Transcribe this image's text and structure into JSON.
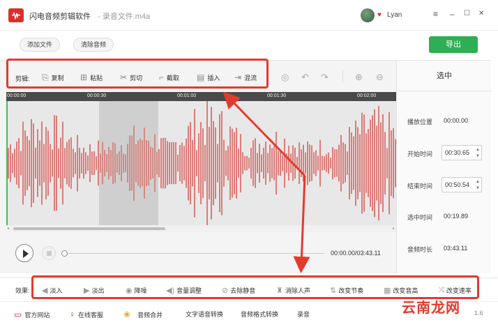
{
  "app": {
    "title": "闪电音频剪辑软件",
    "file_title": "- 录音文件.m4a",
    "user_name": "Lyan"
  },
  "window_controls": {
    "menu": "≡",
    "minimize": "–",
    "maximize": "☐",
    "close": "✕"
  },
  "toolbar": {
    "add_file": "添加文件",
    "clear_audio": "清除音频",
    "export": "导出"
  },
  "edit": {
    "label": "剪辑:",
    "tools": [
      {
        "label": "复制",
        "icon": "copy-icon"
      },
      {
        "label": "粘贴",
        "icon": "paste-icon"
      },
      {
        "label": "剪切",
        "icon": "scissors-icon"
      },
      {
        "label": "截取",
        "icon": "crop-icon"
      },
      {
        "label": "插入",
        "icon": "insert-icon"
      },
      {
        "label": "混流",
        "icon": "mix-icon"
      }
    ],
    "extra_icons": [
      "headphones-icon",
      "undo-icon",
      "redo-icon",
      "zoom-in-icon",
      "zoom-out-icon"
    ]
  },
  "timeline": {
    "ticks": [
      "00:00:00",
      "00:00:30",
      "00:01:00",
      "00:01:30",
      "00:02:00"
    ]
  },
  "selection_panel": {
    "header": "选中",
    "play_position_label": "播放位置",
    "play_position": "00:00.00",
    "start_label": "开始时间",
    "start": "00:30.65",
    "end_label": "结束时间",
    "end": "00:50.54",
    "selected_label": "选中时间",
    "selected": "00:19.89",
    "duration_label": "音频时长",
    "duration": "03:43.11"
  },
  "playback": {
    "time": "00:00.00/03:43.11",
    "progress": 0
  },
  "effects": {
    "label": "效果:",
    "items": [
      {
        "label": "淡入",
        "icon": "fade-in-icon"
      },
      {
        "label": "淡出",
        "icon": "fade-out-icon"
      },
      {
        "label": "降噪",
        "icon": "denoise-icon"
      },
      {
        "label": "音量调整",
        "icon": "volume-icon"
      },
      {
        "label": "去除静音",
        "icon": "mute-icon"
      },
      {
        "label": "消除人声",
        "icon": "vocal-remove-icon"
      },
      {
        "label": "改变节奏",
        "icon": "tempo-icon"
      },
      {
        "label": "改变音高",
        "icon": "pitch-icon"
      },
      {
        "label": "改变速率",
        "icon": "speed-icon"
      }
    ]
  },
  "footer": {
    "links": [
      "官方网站",
      "在线客服",
      "音频合并",
      "文字语音转换",
      "音频格式转换",
      "录音"
    ],
    "version": "1.6",
    "watermark": "云南龙网"
  },
  "colors": {
    "accent": "#d9302c",
    "export_green": "#2fae53",
    "waveform": "#d4413b",
    "highlight": "#e23b2c"
  }
}
